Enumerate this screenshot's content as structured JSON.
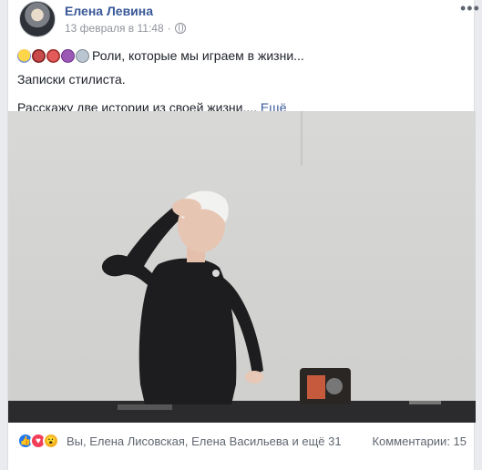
{
  "post": {
    "author": "Елена Левина",
    "date": "13 февраля в 11:48",
    "date_separator": "·",
    "more_label": "•••",
    "line1": "Роли, которые мы играем в жизни...",
    "line2": "Записки стилиста.",
    "line3": "Расскажу две истории из своей жизни....",
    "see_more": "Ещё",
    "emojis": [
      "clown-face-emoji",
      "ogre-mask-emoji",
      "goblin-mask-emoji",
      "imp-devil-emoji",
      "alien-emoji"
    ],
    "photo_description_icon": "photo"
  },
  "footer": {
    "reaction_icons": [
      "like-icon",
      "love-icon",
      "wow-icon"
    ],
    "reactors": "Вы, Елена Лисовская, Елена Васильева и ещё 31",
    "comments": "Комментарии: 15"
  },
  "colors": {
    "link": "#385898",
    "meta": "#90949c",
    "like": "#2078f4",
    "love": "#f33e58",
    "wow": "#f7b125"
  }
}
